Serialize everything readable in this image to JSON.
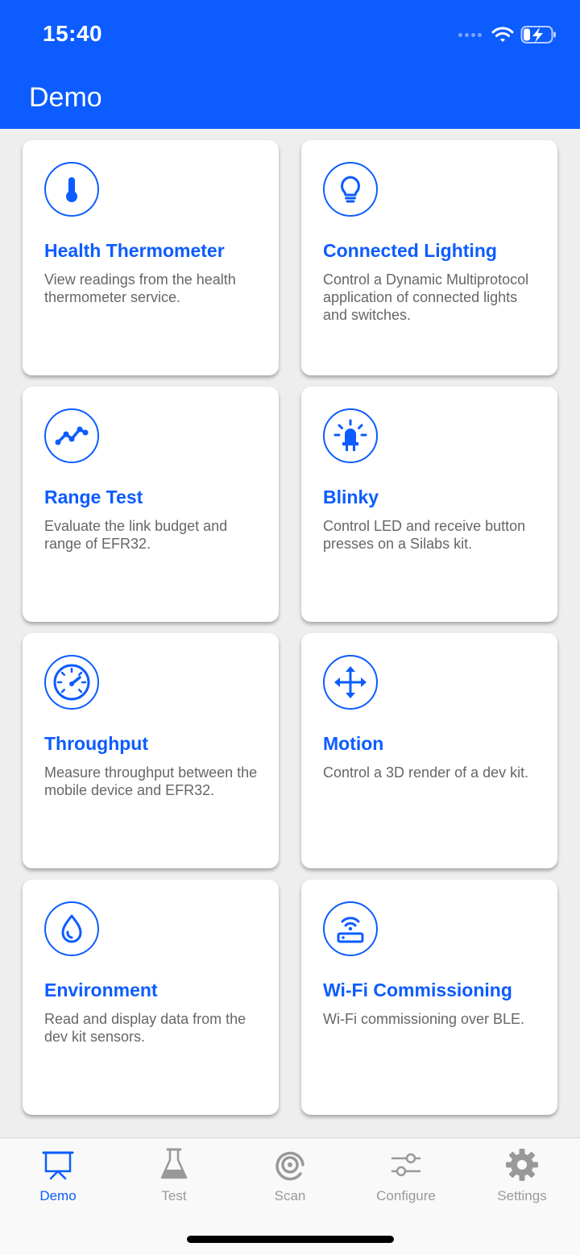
{
  "status": {
    "time": "15:40"
  },
  "header": {
    "title": "Demo"
  },
  "colors": {
    "accent": "#0c5cff",
    "inactive": "#999999"
  },
  "cards": [
    {
      "icon": "thermometer-icon",
      "title": "Health Thermometer",
      "desc": "View readings from the health thermometer service."
    },
    {
      "icon": "lightbulb-icon",
      "title": "Connected Lighting",
      "desc": "Control a Dynamic Multiprotocol application of connected lights and switches."
    },
    {
      "icon": "range-graph-icon",
      "title": "Range Test",
      "desc": "Evaluate the link budget and range of EFR32."
    },
    {
      "icon": "led-icon",
      "title": "Blinky",
      "desc": "Control LED and receive button presses on a Silabs kit."
    },
    {
      "icon": "speedometer-icon",
      "title": "Throughput",
      "desc": "Measure throughput between the mobile device and EFR32."
    },
    {
      "icon": "move-arrows-icon",
      "title": "Motion",
      "desc": "Control a 3D render of a dev kit."
    },
    {
      "icon": "droplet-icon",
      "title": "Environment",
      "desc": "Read and display data from the dev kit sensors."
    },
    {
      "icon": "router-wifi-icon",
      "title": "Wi-Fi Commissioning",
      "desc": "Wi-Fi commissioning over BLE."
    }
  ],
  "tabs": [
    {
      "icon": "presentation-board-icon",
      "label": "Demo",
      "active": true
    },
    {
      "icon": "flask-icon",
      "label": "Test",
      "active": false
    },
    {
      "icon": "scan-target-icon",
      "label": "Scan",
      "active": false
    },
    {
      "icon": "sliders-icon",
      "label": "Configure",
      "active": false
    },
    {
      "icon": "gear-icon",
      "label": "Settings",
      "active": false
    }
  ]
}
